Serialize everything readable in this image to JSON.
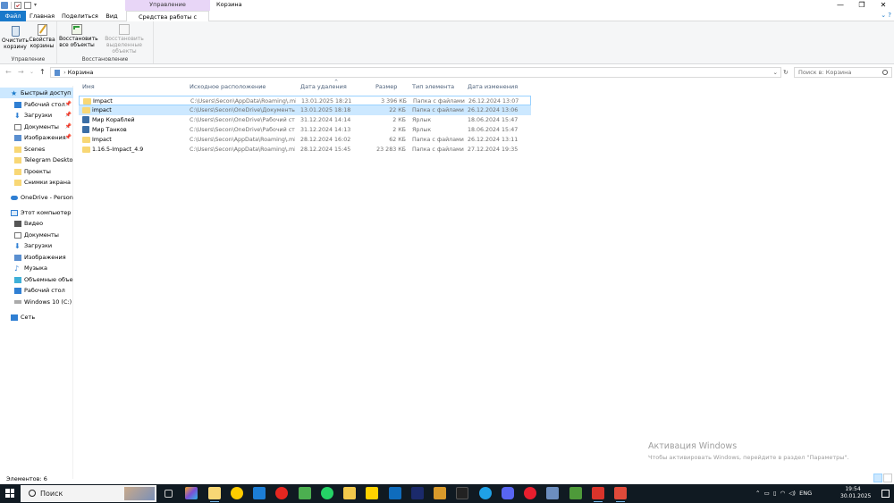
{
  "window": {
    "title": "Корзина",
    "context_tab": "Управление",
    "minimize": "—",
    "maximize": "❐",
    "close": "✕"
  },
  "tabs": {
    "file": "Файл",
    "home": "Главная",
    "share": "Поделиться",
    "view": "Вид",
    "tools": "Средства работы с корзиной"
  },
  "ribbon": {
    "btn_empty": "Очистить корзину",
    "btn_props": "Свойства корзины",
    "group_manage": "Управление",
    "btn_restore_all": "Восстановить все объекты",
    "btn_restore_sel": "Восстановить выделенные объекты",
    "group_restore": "Восстановление"
  },
  "address": {
    "path": "Корзина",
    "search_placeholder": "Поиск в: Корзина"
  },
  "sidebar": {
    "quick_access": "Быстрый доступ",
    "desktop": "Рабочий стол",
    "downloads": "Загрузки",
    "documents": "Документы",
    "pictures": "Изображения",
    "scenes": "Scenes",
    "telegram": "Telegram Desktop",
    "projects": "Проекты",
    "screenshots": "Снимки экрана",
    "onedrive": "OneDrive - Personal",
    "this_pc": "Этот компьютер",
    "video": "Видео",
    "pc_documents": "Документы",
    "pc_downloads": "Загрузки",
    "pc_pictures": "Изображения",
    "music": "Музыка",
    "objects3d": "Объемные объекты",
    "pc_desktop": "Рабочий стол",
    "windows": "Windows 10 (C:)",
    "network": "Сеть"
  },
  "columns": {
    "name": "Имя",
    "location": "Исходное расположение",
    "deleted": "Дата удаления",
    "size": "Размер",
    "type": "Тип элемента",
    "modified": "Дата изменения"
  },
  "files": [
    {
      "name": "Impact",
      "location": "C:\\Users\\Secon\\AppData\\Roaming\\.min...",
      "deleted": "13.01.2025 18:21",
      "size": "3 396 КБ",
      "type": "Папка с файлами",
      "modified": "26.12.2024 13:07",
      "kind": "folder"
    },
    {
      "name": "impact",
      "location": "C:\\Users\\Secon\\OneDrive\\Документы\\I...",
      "deleted": "13.01.2025 18:18",
      "size": "22 КБ",
      "type": "Папка с файлами",
      "modified": "26.12.2024 13:06",
      "kind": "folder"
    },
    {
      "name": "Мир Кораблей",
      "location": "C:\\Users\\Secon\\OneDrive\\Рабочий стол",
      "deleted": "31.12.2024 14:14",
      "size": "2 КБ",
      "type": "Ярлык",
      "modified": "18.06.2024 15:47",
      "kind": "shortcut"
    },
    {
      "name": "Мир Танков",
      "location": "C:\\Users\\Secon\\OneDrive\\Рабочий стол",
      "deleted": "31.12.2024 14:13",
      "size": "2 КБ",
      "type": "Ярлык",
      "modified": "18.06.2024 15:47",
      "kind": "shortcut"
    },
    {
      "name": "Impact",
      "location": "C:\\Users\\Secon\\AppData\\Roaming\\.min...",
      "deleted": "28.12.2024 16:02",
      "size": "62 КБ",
      "type": "Папка с файлами",
      "modified": "26.12.2024 13:11",
      "kind": "folder"
    },
    {
      "name": "1.16.5-Impact_4.9",
      "location": "C:\\Users\\Secon\\AppData\\Roaming\\.min...",
      "deleted": "28.12.2024 15:45",
      "size": "23 283 КБ",
      "type": "Папка с файлами",
      "modified": "27.12.2024 19:35",
      "kind": "folder"
    }
  ],
  "status": {
    "items": "Элементов: 6"
  },
  "watermark": {
    "line1": "Активация Windows",
    "line2": "Чтобы активировать Windows, перейдите в раздел \"Параметры\"."
  },
  "taskbar": {
    "search": "Поиск",
    "lang": "ENG",
    "time": "19:54",
    "date": "30.01.2025"
  },
  "colors": {
    "accent": "#1979ca",
    "selection": "#cce8ff",
    "context_tab": "#e8d6f7",
    "taskbar": "#101a22"
  }
}
